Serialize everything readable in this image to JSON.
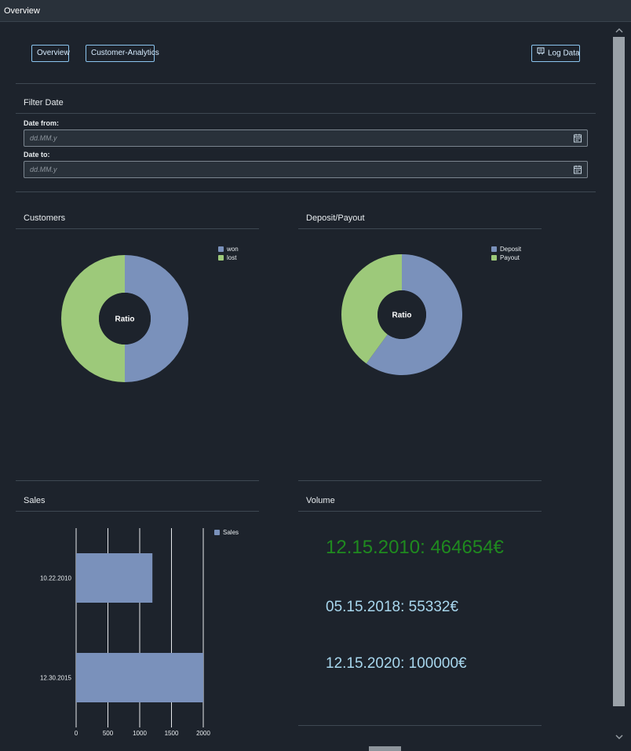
{
  "window": {
    "title": "Overview"
  },
  "nav": {
    "overview_label": "Overview",
    "customer_analytics_label": "Customer-Analytics",
    "log_data_label": "Log Data",
    "log_data_icon": "log-icon"
  },
  "filter": {
    "title": "Filter Date",
    "date_from_label": "Date from:",
    "date_from_placeholder": "dd.MM.y",
    "date_from_value": "",
    "date_to_label": "Date to:",
    "date_to_placeholder": "dd.MM.y",
    "date_to_value": "",
    "calendar_icon": "calendar-icon"
  },
  "customers": {
    "title": "Customers",
    "center_label": "Ratio",
    "legend": [
      {
        "label": "won",
        "color": "#7a91bb"
      },
      {
        "label": "lost",
        "color": "#9dc97a"
      }
    ]
  },
  "deposit": {
    "title": "Deposit/Payout",
    "center_label": "Ratio",
    "legend": [
      {
        "label": "Deposit",
        "color": "#7a91bb"
      },
      {
        "label": "Payout",
        "color": "#9dc97a"
      }
    ]
  },
  "sales": {
    "title": "Sales",
    "legend": [
      {
        "label": "Sales",
        "color": "#7a91bb"
      }
    ]
  },
  "volume": {
    "title": "Volume",
    "entries": [
      {
        "text": "12.15.2010: 464654€",
        "color": "#1f8a1f"
      },
      {
        "text": "05.15.2018: 55332€",
        "color": "#a8d7ee"
      },
      {
        "text": "12.15.2020: 100000€",
        "color": "#a8d7ee"
      }
    ]
  },
  "chart_data": [
    {
      "type": "pie",
      "title": "Customers",
      "donut": true,
      "center_label": "Ratio",
      "labels": [
        "won",
        "lost"
      ],
      "values": [
        50,
        50
      ],
      "colors": [
        "#7a91bb",
        "#9dc97a"
      ],
      "legend": "top-right"
    },
    {
      "type": "pie",
      "title": "Deposit/Payout",
      "donut": true,
      "center_label": "Ratio",
      "labels": [
        "Deposit",
        "Payout"
      ],
      "values": [
        60,
        40
      ],
      "colors": [
        "#7a91bb",
        "#9dc97a"
      ],
      "legend": "top-right"
    },
    {
      "type": "bar",
      "orientation": "horizontal",
      "title": "Sales",
      "categories": [
        "10.22.2010",
        "12.30.2015"
      ],
      "series": [
        {
          "name": "Sales",
          "values": [
            1200,
            2000
          ],
          "color": "#7a91bb"
        }
      ],
      "xlim": [
        0,
        2000
      ],
      "xticks": [
        0,
        500,
        1000,
        1500,
        2000
      ],
      "grid": true,
      "legend": "top-right"
    }
  ]
}
